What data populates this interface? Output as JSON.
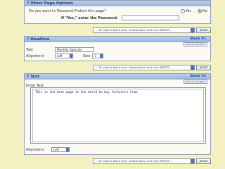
{
  "other_options": {
    "title": "? Other Page Options",
    "password_question": "Do you want to Password-Protect this page?",
    "yes_label": "Yes",
    "no_label": "No",
    "password_prompt": "If \"Yes,\" enter the Password."
  },
  "insert": {
    "prompt": "-- To insert a block here, choose block and click INSERT --",
    "button": "Insert"
  },
  "headline_block": {
    "title": "? Headline",
    "block_label": "Block #1",
    "remove_label": "Remove this Block",
    "text_label": "Text",
    "text_value": "Monthly Specials",
    "alignment_label": "Alignment",
    "alignment_value": "Left",
    "size_label": "Size",
    "size_value": "1"
  },
  "text_block": {
    "title": "? Text",
    "block_label": "Block #2",
    "remove_label": "Remove this Block",
    "enter_text_label": "Enter Text",
    "text_value": "This is the best page in the world to buy furniture from.",
    "alignment_label": "Alignment",
    "alignment_value": "Left"
  },
  "colors": {
    "background": "#f3f1c2",
    "panel_header": "#9ab3d6",
    "title_text": "#1c3f8a"
  }
}
